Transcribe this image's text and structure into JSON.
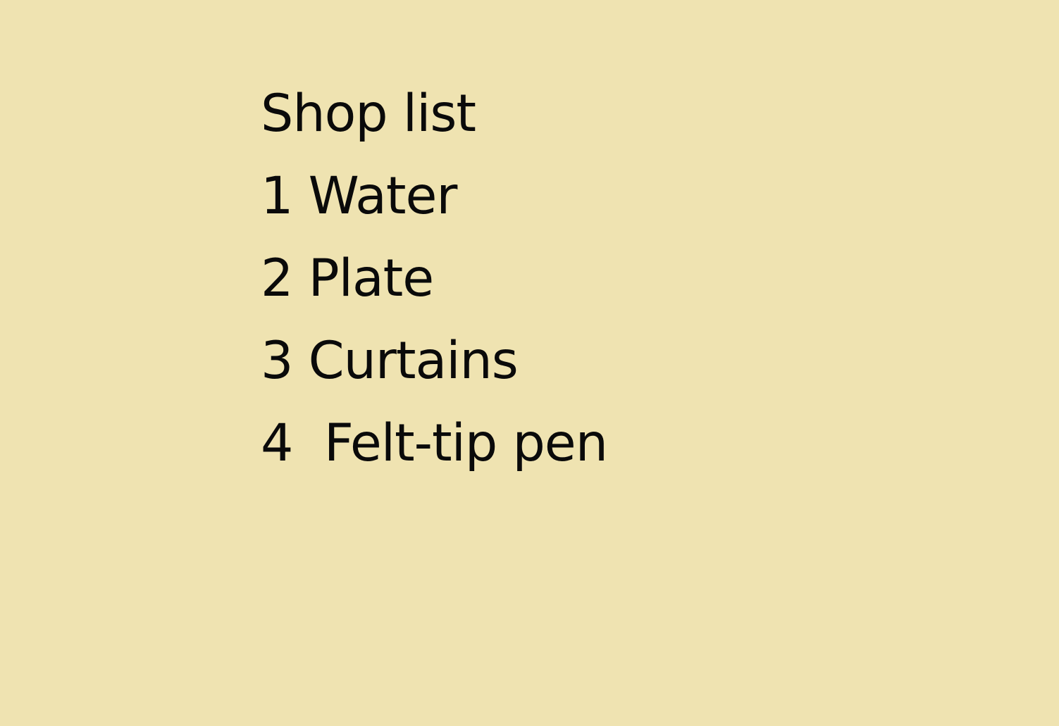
{
  "background_color": "#efe3b1",
  "text_color": "#0a0a0a",
  "list": {
    "title": "Shop list",
    "items": [
      "1 Water",
      "2 Plate",
      "3 Curtains",
      "4  Felt-tip pen"
    ]
  }
}
